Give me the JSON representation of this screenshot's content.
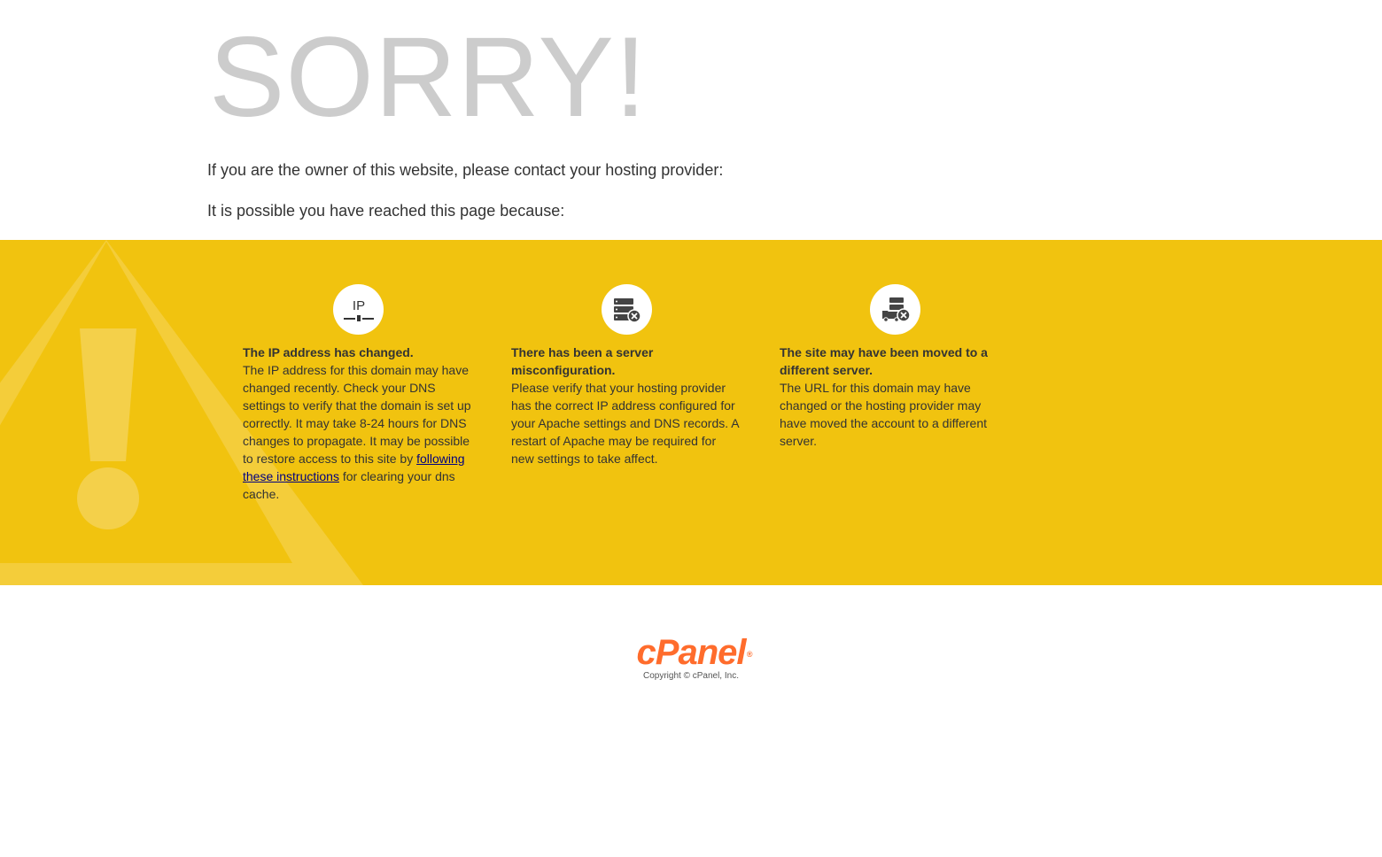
{
  "header": {
    "title": "SORRY!",
    "line1": "If you are the owner of this website, please contact your hosting provider:",
    "line2": "It is possible you have reached this page because:"
  },
  "reasons": [
    {
      "icon": "ip-icon",
      "icon_text": "IP",
      "title": "The IP address has changed.",
      "body": "The IP address for this domain may have changed recently. Check your DNS settings to verify that the domain is set up correctly. It may take 8-24 hours for DNS changes to propagate. It may be possible to restore access to this site by ",
      "link": "following these instructions",
      "body_after": " for clearing your dns cache."
    },
    {
      "icon": "server-error-icon",
      "title": "There has been a server misconfiguration.",
      "body": "Please verify that your hosting provider has the correct IP address configured for your Apache settings and DNS records. A restart of Apache may be required for new settings to take affect."
    },
    {
      "icon": "server-moved-icon",
      "title": "The site may have been moved to a different server.",
      "body": "The URL for this domain may have changed or the hosting provider may have moved the account to a different server."
    }
  ],
  "footer": {
    "logo": "cPanel",
    "registered": "®",
    "copyright": "Copyright © cPanel, Inc."
  },
  "colors": {
    "band": "#f1c30f",
    "title": "#cccccc",
    "logo": "#ff6c2c",
    "link": "#000080"
  }
}
